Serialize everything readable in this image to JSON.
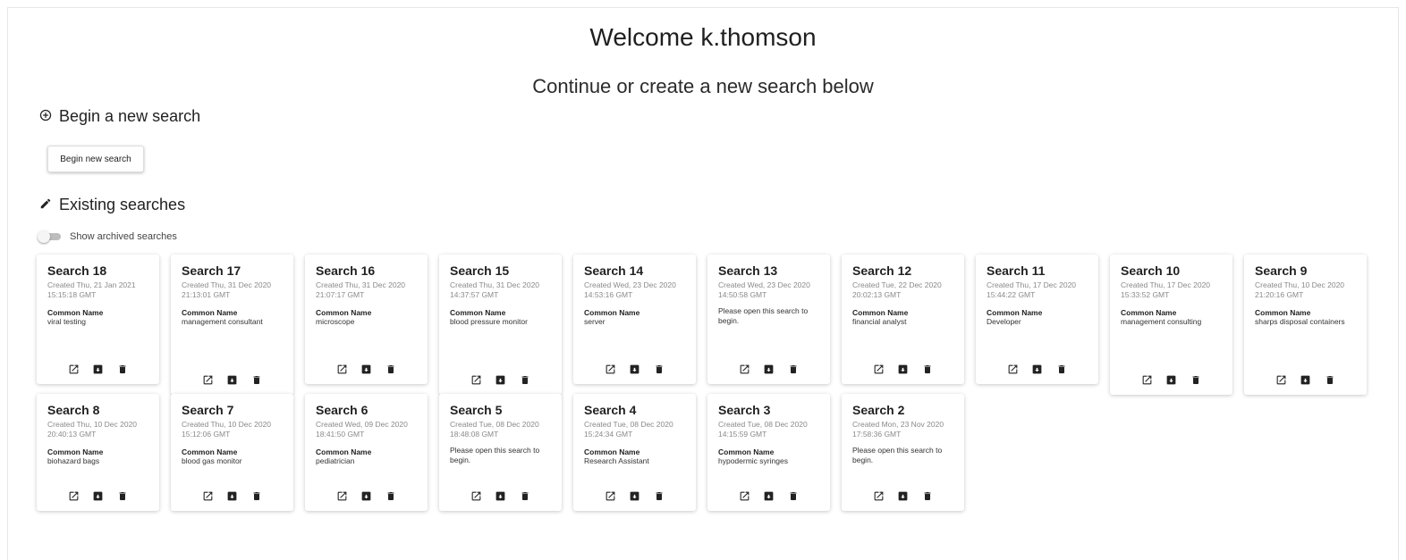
{
  "header": {
    "welcome": "Welcome k.thomson",
    "subtitle": "Continue or create a new search below"
  },
  "new_search": {
    "heading": "Begin a new search",
    "button_label": "Begin new search"
  },
  "existing": {
    "heading": "Existing searches",
    "archived_toggle_label": "Show archived searches",
    "archived_toggle_on": false
  },
  "icons": {
    "new_section": "add-circle-icon",
    "existing_section": "pencil-icon",
    "open": "open-in-new-icon",
    "archive": "archive-icon",
    "delete": "trash-icon"
  },
  "searches": [
    {
      "title": "Search 18",
      "created": "Created Thu, 21 Jan 2021 15:15:18 GMT",
      "label": "Common Name",
      "value": "viral testing"
    },
    {
      "title": "Search 17",
      "created": "Created Thu, 31 Dec 2020 21:13:01 GMT",
      "label": "Common Name",
      "value": "management consultant"
    },
    {
      "title": "Search 16",
      "created": "Created Thu, 31 Dec 2020 21:07:17 GMT",
      "label": "Common Name",
      "value": "microscope"
    },
    {
      "title": "Search 15",
      "created": "Created Thu, 31 Dec 2020 14:37:57 GMT",
      "label": "Common Name",
      "value": "blood pressure monitor"
    },
    {
      "title": "Search 14",
      "created": "Created Wed, 23 Dec 2020 14:53:16 GMT",
      "label": "Common Name",
      "value": "server"
    },
    {
      "title": "Search 13",
      "created": "Created Wed, 23 Dec 2020 14:50:58 GMT",
      "message": "Please open this search to begin."
    },
    {
      "title": "Search 12",
      "created": "Created Tue, 22 Dec 2020 20:02:13 GMT",
      "label": "Common Name",
      "value": "financial analyst"
    },
    {
      "title": "Search 11",
      "created": "Created Thu, 17 Dec 2020 15:44:22 GMT",
      "label": "Common Name",
      "value": "Developer"
    },
    {
      "title": "Search 10",
      "created": "Created Thu, 17 Dec 2020 15:33:52 GMT",
      "label": "Common Name",
      "value": "management consulting"
    },
    {
      "title": "Search 9",
      "created": "Created Thu, 10 Dec 2020 21:20:16 GMT",
      "label": "Common Name",
      "value": "sharps disposal containers"
    },
    {
      "title": "Search 8",
      "created": "Created Thu, 10 Dec 2020 20:40:13 GMT",
      "label": "Common Name",
      "value": "biohazard bags"
    },
    {
      "title": "Search 7",
      "created": "Created Thu, 10 Dec 2020 15:12:06 GMT",
      "label": "Common Name",
      "value": "blood gas monitor"
    },
    {
      "title": "Search 6",
      "created": "Created Wed, 09 Dec 2020 18:41:50 GMT",
      "label": "Common Name",
      "value": "pediatrician"
    },
    {
      "title": "Search 5",
      "created": "Created Tue, 08 Dec 2020 18:48:08 GMT",
      "message": "Please open this search to begin."
    },
    {
      "title": "Search 4",
      "created": "Created Tue, 08 Dec 2020 15:24:34 GMT",
      "label": "Common Name",
      "value": "Research Assistant"
    },
    {
      "title": "Search 3",
      "created": "Created Tue, 08 Dec 2020 14:15:59 GMT",
      "label": "Common Name",
      "value": "hypodermic syringes"
    },
    {
      "title": "Search 2",
      "created": "Created Mon, 23 Nov 2020 17:58:36 GMT",
      "message": "Please open this search to begin."
    }
  ]
}
